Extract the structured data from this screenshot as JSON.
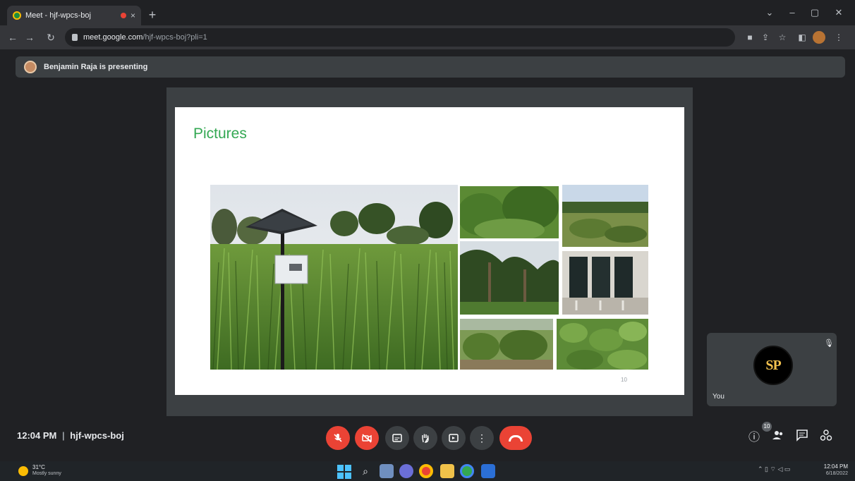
{
  "browser": {
    "tab_title": "Meet - hjf-wpcs-boj",
    "tab_close": "×",
    "new_tab": "+",
    "url_host": "meet.google.com",
    "url_path": "/hjf-wpcs-boj?pli=1",
    "window_controls": [
      "⌄",
      "–",
      "▢",
      "✕"
    ]
  },
  "banner": {
    "text": "Benjamin Raja is presenting"
  },
  "slide": {
    "title": "Pictures",
    "page_number": "10"
  },
  "self_tile": {
    "avatar_initials": "SP",
    "label": "You"
  },
  "meeting": {
    "time": "12:04 PM",
    "separator": "|",
    "code": "hjf-wpcs-boj",
    "people_count": "10"
  },
  "taskbar": {
    "weather_temp": "31°C",
    "weather_desc": "Mostly sunny",
    "clock_time": "12:04 PM",
    "clock_date": "6/18/2022"
  },
  "colors": {
    "meet_red": "#ea4335",
    "slide_title_green": "#34a853",
    "control_gray": "#3c4043"
  }
}
